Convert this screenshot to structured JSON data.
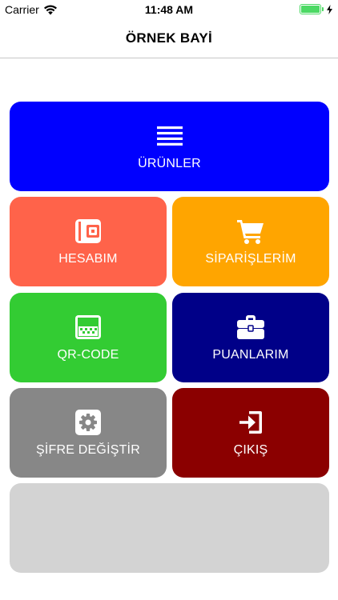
{
  "status_bar": {
    "carrier": "Carrier",
    "time": "11:48 AM",
    "battery_level": 1.0,
    "battery_color": "#4cd964"
  },
  "nav": {
    "title": "ÖRNEK BAYİ"
  },
  "tiles": [
    {
      "label": "ÜRÜNLER",
      "icon": "menu-lines-icon",
      "color": "#0000ff"
    },
    {
      "label": "HESABIM",
      "icon": "wallet-icon",
      "color": "#ff634a"
    },
    {
      "label": "SİPARİŞLERİM",
      "icon": "cart-icon",
      "color": "#ffa500"
    },
    {
      "label": "QR-CODE",
      "icon": "qr-code-icon",
      "color": "#33cc33"
    },
    {
      "label": "PUANLARIM",
      "icon": "briefcase-icon",
      "color": "#000088"
    },
    {
      "label": "ŞİFRE DEĞİŞTİR",
      "icon": "gear-icon",
      "color": "#878787"
    },
    {
      "label": "ÇIKIŞ",
      "icon": "logout-icon",
      "color": "#8b0000"
    },
    {
      "label": "",
      "icon": "",
      "color": "#d3d3d3"
    }
  ]
}
